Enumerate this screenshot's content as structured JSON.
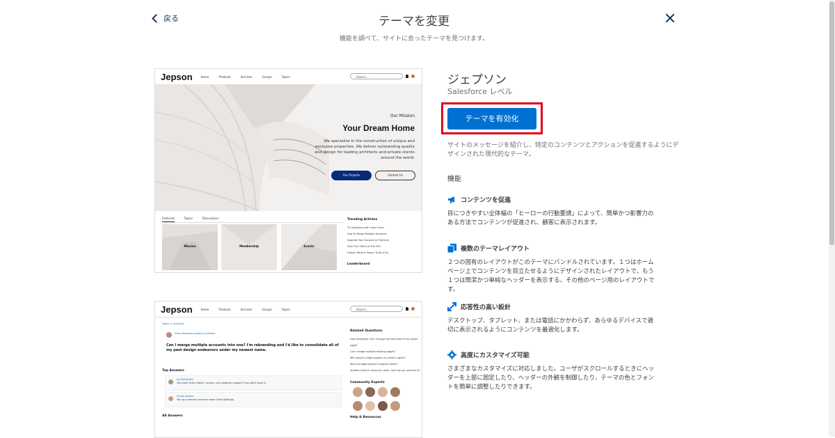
{
  "header": {
    "back_label": "戻る",
    "title": "テーマを変更",
    "subtitle": "機能を調べて、サイトに合ったテーマを見つけます。"
  },
  "preview1": {
    "brand": "Jepson",
    "nav": [
      "Home",
      "Products",
      "Services",
      "Groups",
      "Topics"
    ],
    "search_placeholder": "Search...",
    "mission": "Our Mission",
    "hero_title": "Your Dream Home",
    "hero_desc": "We specialize in the construction of unique and exclusive properties. We deliver outstanding quality and design for leading architects and private clients around the world.",
    "btn_primary": "Our Projects",
    "btn_secondary": "Contact Us",
    "tabs": [
      "Featured",
      "Topics",
      "Discussions"
    ],
    "tiles": [
      "Mission",
      "Membership",
      "Events"
    ],
    "trending_title": "Trending Articles",
    "trending": [
      "75 Questions with Liam Green",
      "How To Merge Multiple Accounts",
      "Upgrade Your Account to Premium",
      "From The Office of The CEO",
      "Ohana: What It Means To All of Us"
    ],
    "leaderboard": "Leaderboard"
  },
  "preview2": {
    "brand": "Jepson",
    "nav": [
      "Home",
      "Products",
      "Services",
      "Groups",
      "Topics"
    ],
    "search_placeholder": "Search...",
    "breadcrumb": "Topics > Accounts",
    "asker": "Drew Matthews asked a Question",
    "question": "Can I merge multiple accounts into one? I'm rebranding and I'd like to consolidate all of my past design endeavors under my newest name.",
    "top_answers": "Top Answers",
    "answers": [
      {
        "name": "Ivy McDonald",
        "text": "You need 'Artist Admin' access, call customer support if you don't have it."
      },
      {
        "name": "Emilio Jaubert",
        "text": "Set up a primary account under Artist Settings."
      }
    ],
    "all_answers": "All Answers",
    "related_title": "Related Questions",
    "related": [
      "How frequently can I change the Macname of my Artist page?",
      "Can I merge multiple existing pages?",
      "Will Jepson's Legal support my artist's rights?",
      "Who manages Jepson's Support email?",
      "Another artist is using my name, how can you prevent it?"
    ],
    "experts_title": "Community Experts",
    "help_title": "Help & Resources"
  },
  "theme": {
    "name": "ジェプソン",
    "level": "Salesforce レベル",
    "activate_label": "テーマを有効化",
    "summary": "サイトのメッセージを紹介し、特定のコンテンツとアクションを促進するようにデザインされた現代的なテーマ。",
    "features_heading": "機能"
  },
  "features": [
    {
      "icon": "megaphone-icon",
      "title": "コンテンツを促進",
      "body": "目につきやすい全体幅の「ヒーローの行動要請」によって、簡単かつ影響力のある方法でコンテンツが促進され、顧客に表示されます。"
    },
    {
      "icon": "layout-icon",
      "title": "複数のテーマレイアウト",
      "body": "２つの固有のレイアウトがこのテーマにバンドルされています。１つはホームページ上でコンテンツを目立たせるようにデザインされたレイアウトで、もう１つは簡潔かつ単純なヘッダーを表示する、その他のページ用のレイアウトです。"
    },
    {
      "icon": "expand-icon",
      "title": "応答性の高い設計",
      "body": "デスクトップ、タブレット、または電話にかかわらず、あらゆるデバイスで適切に表示されるようにコンテンツを最適化します。"
    },
    {
      "icon": "gear-icon",
      "title": "高度にカスタマイズ可能",
      "body": "さまざまなカスタマイズに対応しました。ユーザがスクロールするときにヘッダーを上部に固定したり、ヘッダーの外観を制御したり、テーマの色とフォントを簡単に調整したりできます。"
    }
  ],
  "colors": {
    "accent": "#0070d2",
    "highlight": "#e0001b",
    "text": "#3e3e3c"
  }
}
